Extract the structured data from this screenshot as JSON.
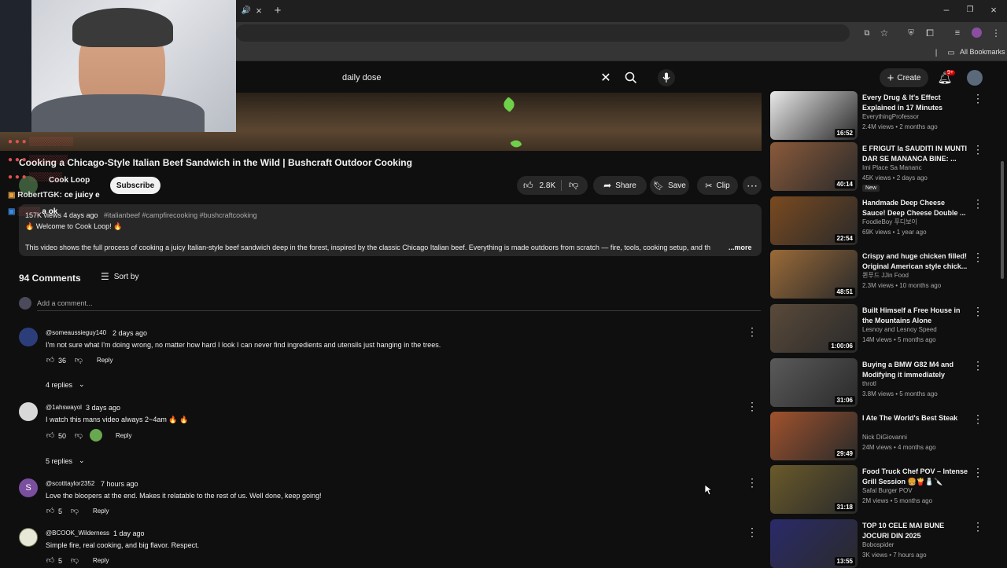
{
  "browser": {
    "bookmarks_label": "All Bookmarks"
  },
  "youtube": {
    "search_query": "daily dose",
    "create_label": "Create",
    "notification_count": "9+"
  },
  "video": {
    "title": "Cooking a Chicago-Style Italian Beef Sandwich in the Wild | Bushcraft Outdoor Cooking",
    "channel": "Cook Loop",
    "subscribe_label": "Subscribe",
    "likes": "2.8K",
    "share_label": "Share",
    "save_label": "Save",
    "clip_label": "Clip",
    "views_meta": "157K views 4 days ago",
    "hashtags": "#italianbeef #campfirecooking #bushcraftcooking",
    "welcome": "🔥 Welcome to Cook Loop! 🔥",
    "description": "This video shows the full process of cooking a juicy Italian-style beef sandwich deep in the forest, inspired by the classic Chicago Italian beef. Everything is made outdoors from scratch — fire, tools, cooking setup, and th",
    "more_label": "...more"
  },
  "comments": {
    "count_label": "94 Comments",
    "sort_label": "Sort by",
    "add_placeholder": "Add a comment...",
    "items": [
      {
        "author": "@someaussieguy140",
        "time": "2 days ago",
        "text": "I'm not sure what I'm doing wrong, no matter how hard I look I can never find ingredients and utensils just hanging in the trees.",
        "likes": "36",
        "reply": "Reply",
        "replies": "4 replies"
      },
      {
        "author": "@1ahswayol",
        "time": "3 days ago",
        "text": "I watch this mans video always 2~4am 🔥 🔥",
        "likes": "50",
        "reply": "Reply",
        "replies": "5 replies"
      },
      {
        "author": "@scotttaylor2352",
        "time": "7 hours ago",
        "text": "Love the bloopers at the end. Makes it relatable to the rest of us. Well done, keep going!",
        "likes": "5",
        "reply": "Reply",
        "avatar_letter": "S"
      },
      {
        "author": "@BCOOK_Wilderness",
        "time": "1 day ago",
        "text": "Simple fire, real cooking, and big flavor. Respect.",
        "likes": "5",
        "reply": "Reply"
      }
    ]
  },
  "chat": {
    "lines": [
      {
        "user": "RobertTGK:",
        "msg": "ce juicy e"
      },
      {
        "user": "",
        "msg": "a ok"
      }
    ]
  },
  "recommendations": [
    {
      "title": "Every Drug & It's Effect Explained in 17 Minutes",
      "channel": "EverythingProfessor",
      "meta": "2.4M views • 2 months ago",
      "duration": "16:52",
      "color": "#e9e9e9"
    },
    {
      "title": "E FRIGUT la SAUDITI IN MUNTI DAR SE MANANCA BINE: ...",
      "channel": "Imi Place Sa Mananc",
      "meta": "45K views • 2 days ago",
      "badge": "New",
      "duration": "40:14",
      "color": "#8a5a3a"
    },
    {
      "title": "Handmade Deep Cheese Sauce! Deep Cheese Double ...",
      "channel": "FoodieBoy 푸디보이",
      "meta": "69K views • 1 year ago",
      "duration": "22:54",
      "color": "#7a4a20"
    },
    {
      "title": "Crispy and huge chicken filled! Original American style chick...",
      "channel": "퀸푸드 JJin Food",
      "meta": "2.3M views • 10 months ago",
      "duration": "48:51",
      "color": "#9a6a38"
    },
    {
      "title": "Built Himself a Free House in the Mountains Alone",
      "channel": "Lesnoy and Lesnoy Speed",
      "meta": "14M views • 5 months ago",
      "duration": "1:00:06",
      "color": "#5a4a3a"
    },
    {
      "title": "Buying a BMW G82 M4 and Modifying it immediately",
      "channel": "throtl",
      "meta": "3.8M views • 5 months ago",
      "duration": "31:06",
      "color": "#5a5a5a"
    },
    {
      "title": "I Ate The World's Best Steak",
      "channel": "Nick DiGiovanni",
      "meta": "24M views • 4 months ago",
      "duration": "29:49",
      "color": "#a0522d"
    },
    {
      "title": "Food Truck Chef POV – Intense Grill Session 🍔🍟🧂🔪",
      "channel": "Safal Burger POV",
      "meta": "2M views • 5 months ago",
      "duration": "31:18",
      "color": "#6a5a2a"
    },
    {
      "title": "TOP 10 CELE MAI BUNE JOCURI DIN 2025",
      "channel": "Bobospider",
      "meta": "3K views • 7 hours ago",
      "duration": "13:55",
      "color": "#2a2a6a"
    }
  ]
}
